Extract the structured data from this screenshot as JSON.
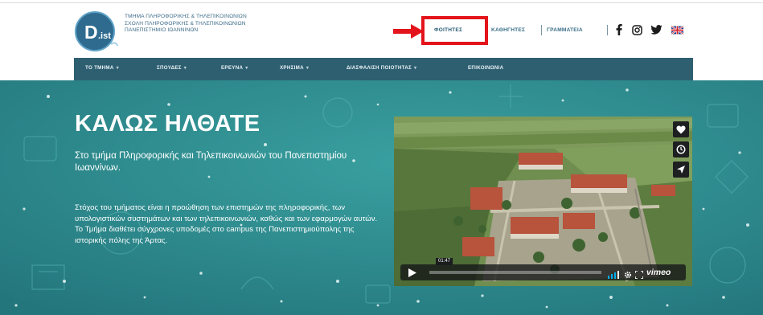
{
  "header": {
    "logo_text": "D.ist",
    "institution_lines": [
      "ΤΜΗΜΑ ΠΛΗΡΟΦΟΡΙΚΗΣ & ΤΗΛΕΠΙΚΟΙΝΩΝΙΩΝ",
      "ΣΧΟΛΗ ΠΛΗΡΟΦΟΡΙΚΗΣ & ΤΗΛΕΠΙΚΟΙΝΩΝΙΩΝ",
      "ΠΑΝΕΠΙΣΤΗΜΙΟ ΙΩΑΝΝΙΝΩΝ"
    ],
    "top_links": {
      "students": "ΦΟΙΤΗΤΕΣ",
      "teachers": "ΚΑΘΗΓΗΤΕΣ",
      "secretary": "ΓΡΑΜΜΑΤΕΙΑ"
    },
    "social_icons": [
      "facebook-icon",
      "instagram-icon",
      "twitter-icon",
      "uk-flag-icon"
    ]
  },
  "main_nav": [
    {
      "label": "ΤΟ ΤΜΗΜΑ",
      "has_dropdown": true
    },
    {
      "label": "ΣΠΟΥΔΕΣ",
      "has_dropdown": true
    },
    {
      "label": "ΕΡΕΥΝΑ",
      "has_dropdown": true
    },
    {
      "label": "ΧΡΗΣΙΜΑ",
      "has_dropdown": true
    },
    {
      "label": "ΔΙΑΣΦΑΛΙΣΗ ΠΟΙΟΤΗΤΑΣ",
      "has_dropdown": true
    },
    {
      "label": "ΕΠΙΚΟΙΝΩΝΙΑ",
      "has_dropdown": false
    }
  ],
  "hero": {
    "title": "ΚΑΛΩΣ ΗΛΘΑΤΕ",
    "subtitle": "Στο τμήμα Πληροφορικής και Τηλεπικοινωνιών του Πανεπιστημίου Ιωαννίνων.",
    "body": "Στόχος του τμήματος είναι η προώθηση των επιστημών της πληροφορικής, των υπολογιστικών συστημάτων και των τηλεπικοινωνιών, καθώς και των εφαρμογών αυτών. Το Τμήμα διαθέτει σύγχρονες υποδομές στο campus της Πανεπιστημιούπολης της ιστορικής πόλης της Άρτας."
  },
  "video": {
    "time_label": "01:47",
    "brand": "vimeo",
    "progress_fraction": 0.0,
    "side_icons": [
      "heart-icon",
      "clock-icon",
      "share-icon"
    ],
    "control_icons": [
      "play-icon",
      "volume-icon",
      "settings-icon",
      "fullscreen-icon"
    ]
  },
  "colors": {
    "accent_red": "#e3141b",
    "nav_bar": "#2e5f71",
    "hero_teal": "#2d8b8e",
    "link_blue": "#3b6f89"
  }
}
